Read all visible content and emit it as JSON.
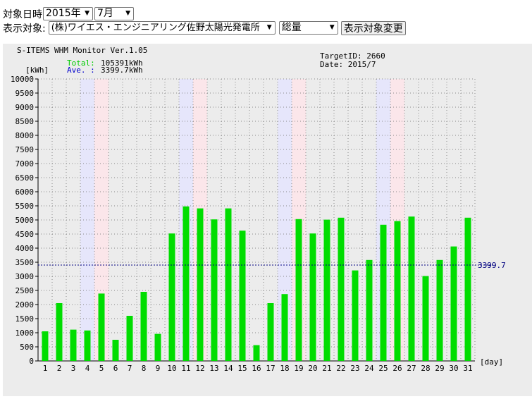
{
  "form": {
    "date_label": "対象日時",
    "year_value": "2015年",
    "month_value": "7月",
    "target_label": "表示対象:",
    "target_value": "(株)ワイエス・エンジニアリング佐野太陽光発電所",
    "kind_value": "総量",
    "change_button": "表示対象変更",
    "dropdown_icon": "triangle-down"
  },
  "header": {
    "app_title": "S-ITEMS WHM Monitor Ver.1.05",
    "target_id": "TargetID: 2660",
    "date": "Date: 2015/7",
    "total_label": "Total:",
    "total_value": "105391kWh",
    "ave_label": "Ave. :",
    "ave_value": "3399.7kWh",
    "total_color": "#00cc00",
    "ave_color": "#0000cc"
  },
  "chart_data": {
    "type": "bar",
    "ylabel": "[kWh]",
    "xlabel": "[day]",
    "ylim": [
      0,
      10000
    ],
    "ytick_step": 500,
    "categories": [
      "1",
      "2",
      "3",
      "4",
      "5",
      "6",
      "7",
      "8",
      "9",
      "10",
      "11",
      "12",
      "13",
      "14",
      "15",
      "16",
      "17",
      "18",
      "19",
      "20",
      "21",
      "22",
      "23",
      "24",
      "25",
      "26",
      "27",
      "28",
      "29",
      "30",
      "31"
    ],
    "values": [
      1050,
      2050,
      1110,
      1080,
      2390,
      750,
      1600,
      2450,
      960,
      4520,
      5480,
      5410,
      5020,
      5410,
      4620,
      560,
      2050,
      2370,
      5030,
      4520,
      5010,
      5080,
      3210,
      3580,
      4830,
      4960,
      5120,
      3010,
      3580,
      4060,
      5080
    ],
    "average": 3399.7,
    "average_label": "3399.7",
    "saturdays": [
      4,
      11,
      18,
      25
    ],
    "sundays": [
      5,
      12,
      19,
      26
    ],
    "bar_color": "#00dd00",
    "average_color": "#000080",
    "saturday_color": "#e6e6fb",
    "sunday_color": "#fbe6ea",
    "grid": true
  }
}
